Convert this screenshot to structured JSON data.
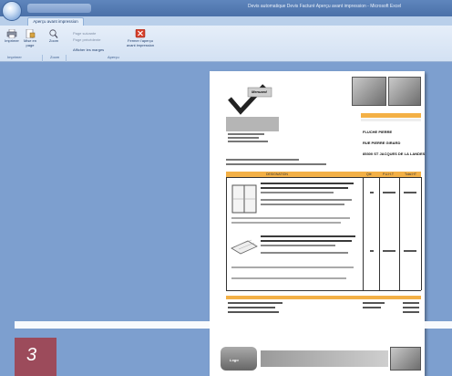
{
  "window": {
    "title": "Devis automatique Devis Facturé Aperçu avant impression - Microsoft Excel"
  },
  "tabs": {
    "active_label": "Aperçu avant impression"
  },
  "ribbon": {
    "print_label": "Imprimer",
    "page_setup_label": "Mise en page",
    "zoom_label": "Zoom",
    "next_page_label": "Page suivante",
    "prev_page_label": "Page précédente",
    "show_margins_label": "Afficher les marges",
    "close_label": "Fermer l'aperçu avant impression",
    "groups": {
      "print": "Imprimer",
      "zoom": "Zoom",
      "preview": "Aperçu"
    }
  },
  "document": {
    "logo_text": "Menuard",
    "client_name": "FLUCHE PIERRE",
    "client_address": "RUE PIERRE GIRARD",
    "client_city": "85300 ST JACQUES DE LA LANDES",
    "table_headers": [
      "DESIGNATION",
      "Qté",
      "P.U.H.T",
      "Total HT"
    ],
    "footer_logo_text": "Logo"
  },
  "badge": {
    "number": "3"
  },
  "colors": {
    "workspace": "#7d9fcf",
    "badge": "#9c4b5b",
    "accent_orange": "#f3b046"
  }
}
